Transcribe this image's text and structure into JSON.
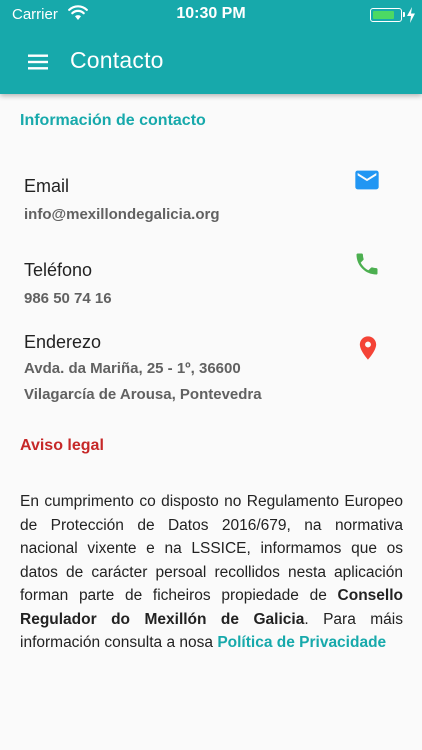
{
  "status_bar": {
    "carrier": "Carrier",
    "time": "10:30 PM",
    "battery_level": 0.85,
    "battery_color": "#4cd964"
  },
  "app_bar": {
    "title": "Contacto",
    "menu_icon": "hamburger-menu-icon",
    "background": "#17a9ab"
  },
  "contact_section": {
    "title": "Información de contacto",
    "items": [
      {
        "label": "Email",
        "value": "info@mexillondegalicia.org",
        "icon": "mail-icon",
        "icon_color": "#2196f3"
      },
      {
        "label": "Teléfono",
        "value": "986 50 74 16",
        "icon": "phone-icon",
        "icon_color": "#4caf50"
      },
      {
        "label": "Enderezo",
        "value_line1": "Avda. da Mariña, 25 - 1º, 36600",
        "value_line2": "Vilagarcía de Arousa, Pontevedra",
        "icon": "location-pin-icon",
        "icon_color": "#f44336"
      }
    ]
  },
  "legal_section": {
    "title": "Aviso legal",
    "text_part1": "En cumprimento co disposto no Regulamento Europeo de Protección de Datos 2016/679, na normativa nacional vixente e na LSSICE, informamos que os datos de carácter persoal recollidos nesta aplicación forman parte de ficheiros propiedade de ",
    "organization": "Consello Regulador do Mexillón de Galicia",
    "text_part2": ". Para máis información consulta a nosa ",
    "privacy_link": "Política de Privacidade",
    "title_color": "#c62828"
  }
}
